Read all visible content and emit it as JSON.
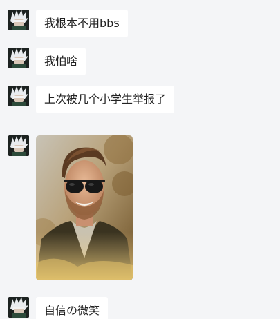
{
  "messages": [
    {
      "type": "text",
      "text": "我根本不用bbs"
    },
    {
      "type": "text",
      "text": "我怕啥"
    },
    {
      "type": "text",
      "text": "上次被几个小学生举报了"
    },
    {
      "type": "image",
      "icon": "photo-smiling-man-sunglasses"
    },
    {
      "type": "text",
      "text": "自信の微笑"
    }
  ],
  "avatar": {
    "icon": "anime-white-hair-avatar-icon"
  },
  "colors": {
    "background": "#f4f5f7",
    "bubble": "#ffffff",
    "text": "#222222"
  }
}
